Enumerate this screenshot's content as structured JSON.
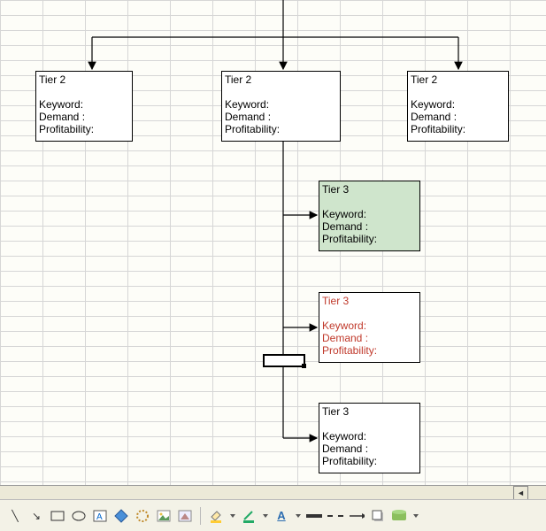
{
  "nodes": {
    "tier2a": {
      "title": "Tier 2",
      "l1": "Keyword:",
      "l2": "Demand :",
      "l3": "Profitability:"
    },
    "tier2b": {
      "title": "Tier 2",
      "l1": "Keyword:",
      "l2": "Demand :",
      "l3": "Profitability:"
    },
    "tier2c": {
      "title": "Tier 2",
      "l1": "Keyword:",
      "l2": "Demand :",
      "l3": "Profitability:"
    },
    "tier3a": {
      "title": "Tier 3",
      "l1": "Keyword:",
      "l2": "Demand :",
      "l3": "Profitability:"
    },
    "tier3b": {
      "title": "Tier 3",
      "l1": "Keyword:",
      "l2": "Demand :",
      "l3": "Profitability:"
    },
    "tier3c": {
      "title": "Tier 3",
      "l1": "Keyword:",
      "l2": "Demand :",
      "l3": "Profitability:"
    }
  },
  "toolbar": {
    "line": "╲",
    "arrow": "↘"
  }
}
